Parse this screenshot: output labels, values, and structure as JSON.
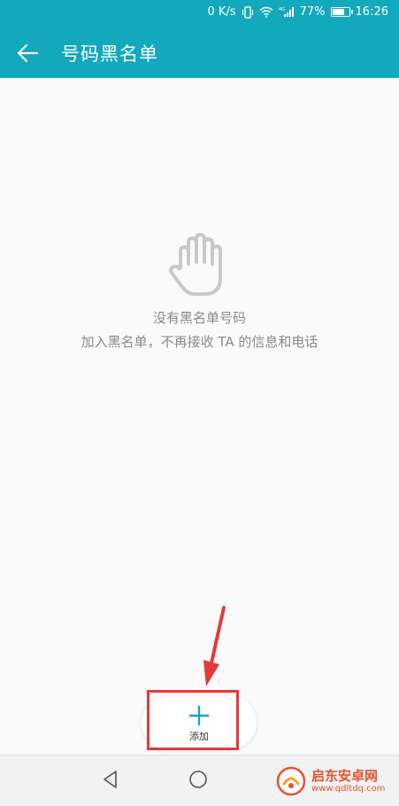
{
  "status_bar": {
    "speed": "0 K/s",
    "network": "4G",
    "battery": "77%",
    "battery_level": 0.77,
    "time": "16:26"
  },
  "app_bar": {
    "title": "号码黑名单",
    "back_icon": "arrow-left-icon"
  },
  "empty_state": {
    "icon": "hand-stop-icon",
    "title": "没有黑名单号码",
    "description": "加入黑名单，不再接收 TA 的信息和电话"
  },
  "add_button": {
    "label": "添加",
    "icon": "plus-icon"
  },
  "nav_bar": {
    "back_icon": "triangle-back-icon",
    "home_icon": "circle-home-icon",
    "recent_icon": "square-recent-icon"
  },
  "watermark": {
    "name": "启东安卓网",
    "url": "www.qdltdq.com"
  },
  "colors": {
    "primary": "#12a9bd",
    "annotation": "#e23b3b",
    "plus": "#12a9bd",
    "empty_text": "#8a8a8a"
  }
}
